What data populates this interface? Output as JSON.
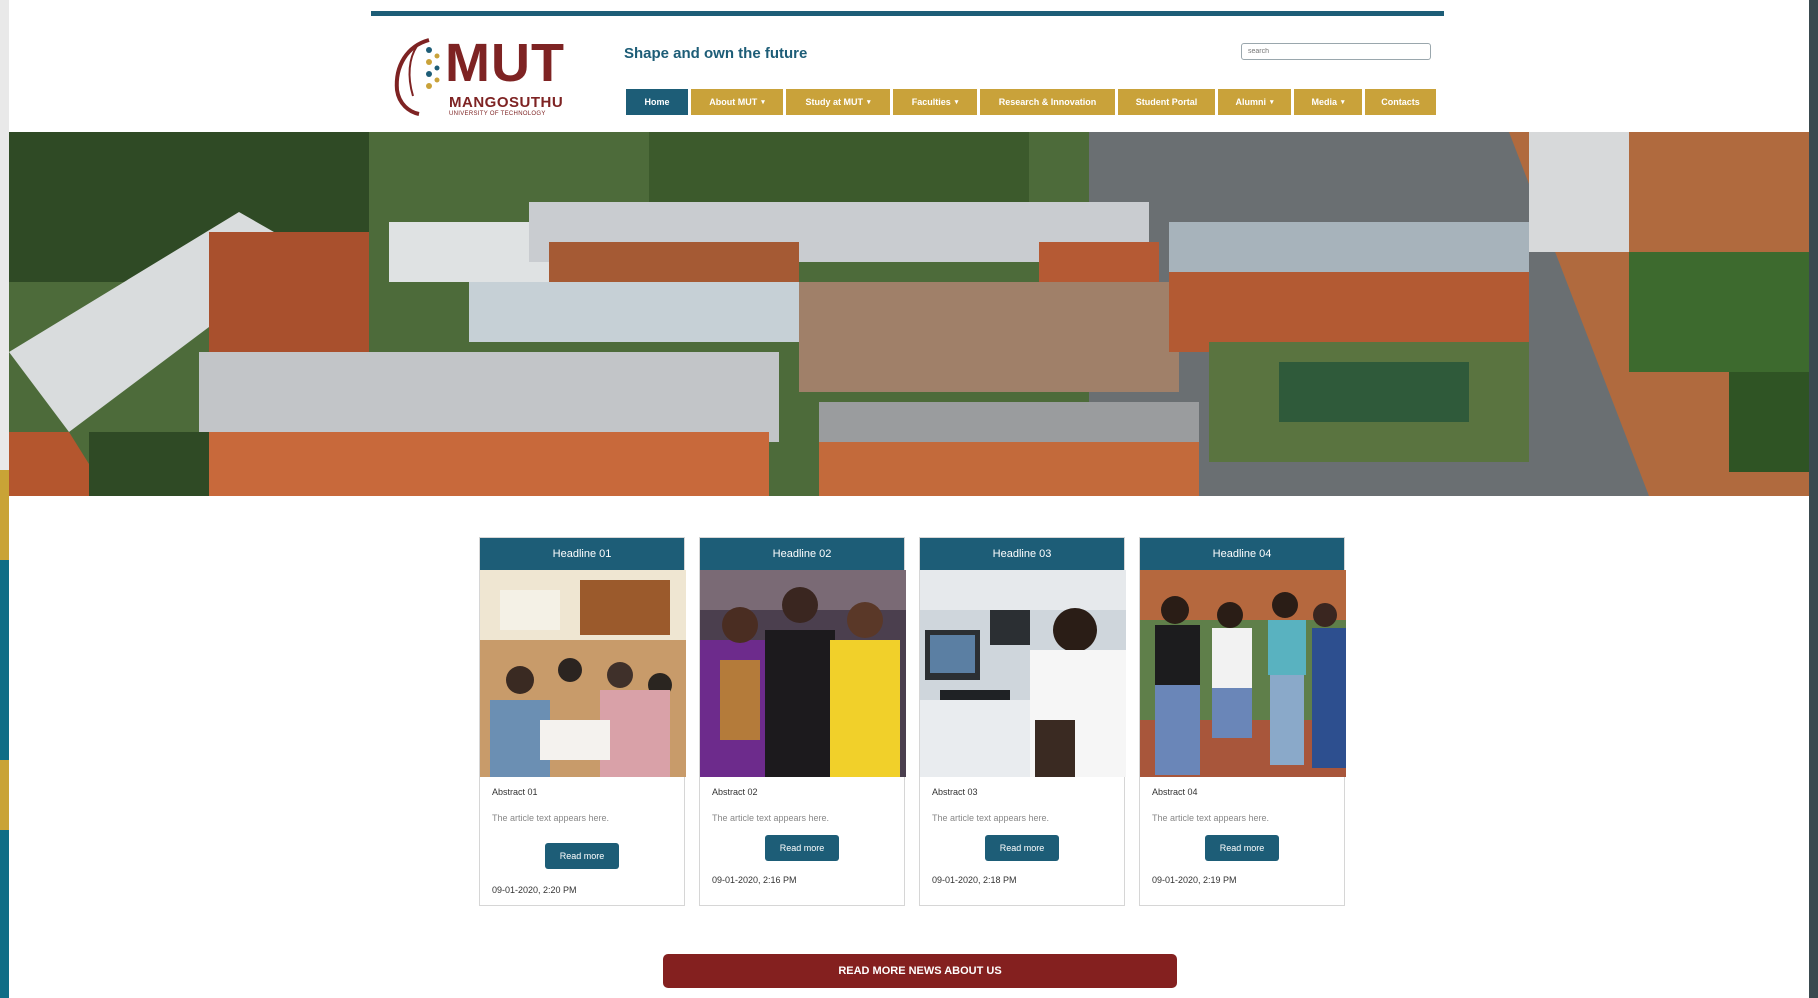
{
  "header": {
    "logo_text": "MUT",
    "logo_name": "MANGOSUTHU",
    "logo_subtitle": "UNIVERSITY OF TECHNOLOGY",
    "tagline": "Shape and own the future",
    "search_placeholder": "search"
  },
  "nav": {
    "items": [
      {
        "label": "Home",
        "dropdown": false
      },
      {
        "label": "About MUT",
        "dropdown": true
      },
      {
        "label": "Study at MUT",
        "dropdown": true
      },
      {
        "label": "Faculties",
        "dropdown": true
      },
      {
        "label": "Research & Innovation",
        "dropdown": false
      },
      {
        "label": "Student Portal",
        "dropdown": false
      },
      {
        "label": "Alumni",
        "dropdown": true
      },
      {
        "label": "Media",
        "dropdown": true
      },
      {
        "label": "Contacts",
        "dropdown": false
      }
    ]
  },
  "cards": [
    {
      "headline": "Headline 01",
      "abstract": "Abstract 01",
      "text": "The article text appears here.",
      "button": "Read more",
      "date": "09-01-2020, 2:20 PM"
    },
    {
      "headline": "Headline 02",
      "abstract": "Abstract 02",
      "text": "The article text appears here.",
      "button": "Read more",
      "date": "09-01-2020, 2:16 PM"
    },
    {
      "headline": "Headline 03",
      "abstract": "Abstract 03",
      "text": "The article text appears here.",
      "button": "Read more",
      "date": "09-01-2020, 2:18 PM"
    },
    {
      "headline": "Headline 04",
      "abstract": "Abstract 04",
      "text": "The article text appears here.",
      "button": "Read more",
      "date": "09-01-2020, 2:19 PM"
    }
  ],
  "news_button": "READ MORE NEWS ABOUT US",
  "colors": {
    "brand_blue": "#1d5d77",
    "brand_gold": "#c9a23a",
    "brand_maroon": "#84201f"
  }
}
